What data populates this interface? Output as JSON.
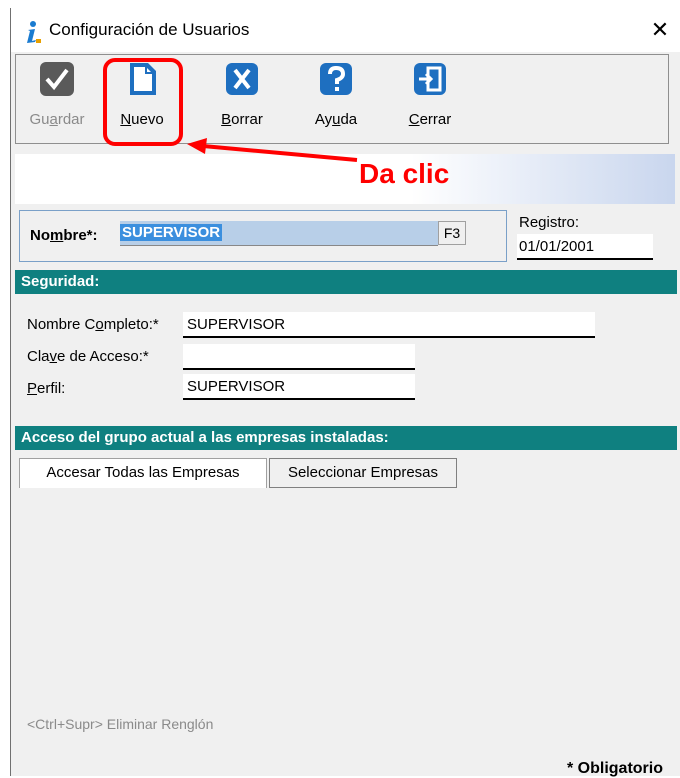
{
  "window": {
    "title": "Configuración de Usuarios",
    "close_glyph": "✕"
  },
  "toolbar": {
    "buttons": [
      {
        "name": "Guardar",
        "pre": "Gu",
        "ul": "a",
        "post": "rdar",
        "enabled": false,
        "icon": "checkmark-icon"
      },
      {
        "name": "Nuevo",
        "pre": "",
        "ul": "N",
        "post": "uevo",
        "enabled": true,
        "icon": "new-document-icon"
      },
      {
        "name": "Borrar",
        "pre": "",
        "ul": "B",
        "post": "orrar",
        "enabled": true,
        "icon": "delete-x-icon"
      },
      {
        "name": "Ayuda",
        "pre": "Ay",
        "ul": "u",
        "post": "da",
        "enabled": true,
        "icon": "help-question-icon"
      },
      {
        "name": "Cerrar",
        "pre": "",
        "ul": "C",
        "post": "errar",
        "enabled": true,
        "icon": "exit-door-icon"
      }
    ]
  },
  "annotation": {
    "text": "Da clic",
    "color": "#ff0000"
  },
  "header": {
    "nombre_pre": "No",
    "nombre_ul": "m",
    "nombre_post": "bre*:",
    "nombre_value": "SUPERVISOR",
    "f3_label": "F3",
    "registro_label": "Registro:",
    "registro_value": "01/01/2001"
  },
  "seguridad": {
    "section_title": "Seguridad:",
    "nombre_completo_pre": "Nombre C",
    "nombre_completo_ul": "o",
    "nombre_completo_post": "mpleto:*",
    "nombre_completo_value": "SUPERVISOR",
    "clave_pre": "Cla",
    "clave_ul": "v",
    "clave_post": "e de Acceso:*",
    "clave_value": "",
    "perfil_pre": "",
    "perfil_ul": "P",
    "perfil_post": "erfil:",
    "perfil_value": "SUPERVISOR"
  },
  "acceso": {
    "section_title": "Acceso del grupo actual a las empresas instaladas:",
    "tabs": [
      "Accesar Todas las Empresas",
      "Seleccionar Empresas"
    ]
  },
  "footer": {
    "hint": "<Ctrl+Supr> Eliminar Renglón",
    "obligatorio": "* Obligatorio"
  },
  "colors": {
    "section_bg": "#0f8080",
    "selection_bg": "#3b8fde",
    "highlight": "#ff0000"
  }
}
